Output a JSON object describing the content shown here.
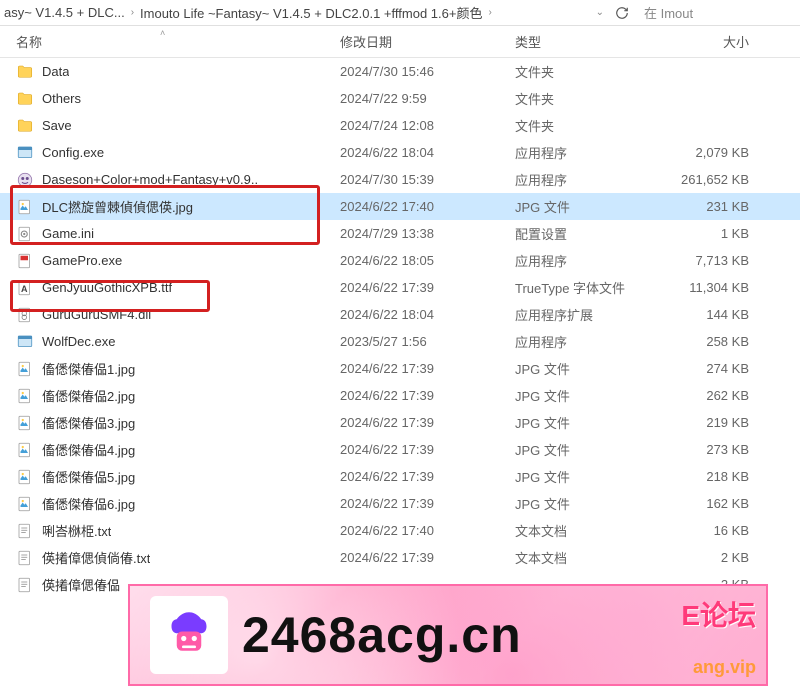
{
  "breadcrumb": {
    "item1": "asy~ V1.4.5 + DLC...",
    "item2": "Imouto Life ~Fantasy~ V1.4.5 + DLC2.0.1 +fffmod 1.6+颜色",
    "search_prefix": "在 Imout"
  },
  "headers": {
    "name": "名称",
    "date": "修改日期",
    "type": "类型",
    "size": "大小"
  },
  "files": [
    {
      "icon": "folder",
      "name": "Data",
      "date": "2024/7/30 15:46",
      "type": "文件夹",
      "size": ""
    },
    {
      "icon": "folder",
      "name": "Others",
      "date": "2024/7/22 9:59",
      "type": "文件夹",
      "size": ""
    },
    {
      "icon": "folder",
      "name": "Save",
      "date": "2024/7/24 12:08",
      "type": "文件夹",
      "size": ""
    },
    {
      "icon": "exe",
      "name": "Config.exe",
      "date": "2024/6/22 18:04",
      "type": "应用程序",
      "size": "2,079 KB"
    },
    {
      "icon": "app",
      "name": "Daseson+Color+mod+Fantasy+v0.9..",
      "date": "2024/7/30 15:39",
      "type": "应用程序",
      "size": "261,652 KB"
    },
    {
      "icon": "jpg",
      "name": "DLC撚旋曾棘偵偵偲偀.jpg",
      "date": "2024/6/22 17:40",
      "type": "JPG 文件",
      "size": "231 KB",
      "selected": true
    },
    {
      "icon": "ini",
      "name": "Game.ini",
      "date": "2024/7/29 13:38",
      "type": "配置设置",
      "size": "1 KB"
    },
    {
      "icon": "exe-red",
      "name": "GamePro.exe",
      "date": "2024/6/22 18:05",
      "type": "应用程序",
      "size": "7,713 KB"
    },
    {
      "icon": "font",
      "name": "GenJyuuGothicXPB.ttf",
      "date": "2024/6/22 17:39",
      "type": "TrueType 字体文件",
      "size": "11,304 KB"
    },
    {
      "icon": "dll",
      "name": "GuruGuruSMF4.dll",
      "date": "2024/6/22 18:04",
      "type": "应用程序扩展",
      "size": "144 KB"
    },
    {
      "icon": "exe",
      "name": "WolfDec.exe",
      "date": "2023/5/27 1:56",
      "type": "应用程序",
      "size": "258 KB"
    },
    {
      "icon": "jpg",
      "name": "傗僁傑偆偘1.jpg",
      "date": "2024/6/22 17:39",
      "type": "JPG 文件",
      "size": "274 KB"
    },
    {
      "icon": "jpg",
      "name": "傗僁傑偆偘2.jpg",
      "date": "2024/6/22 17:39",
      "type": "JPG 文件",
      "size": "262 KB"
    },
    {
      "icon": "jpg",
      "name": "傗僁傑偆偘3.jpg",
      "date": "2024/6/22 17:39",
      "type": "JPG 文件",
      "size": "219 KB"
    },
    {
      "icon": "jpg",
      "name": "傗僁傑偆偘4.jpg",
      "date": "2024/6/22 17:39",
      "type": "JPG 文件",
      "size": "273 KB"
    },
    {
      "icon": "jpg",
      "name": "傗僁傑偆偘5.jpg",
      "date": "2024/6/22 17:39",
      "type": "JPG 文件",
      "size": "218 KB"
    },
    {
      "icon": "jpg",
      "name": "傗僁傑偆偘6.jpg",
      "date": "2024/6/22 17:39",
      "type": "JPG 文件",
      "size": "162 KB"
    },
    {
      "icon": "txt",
      "name": "唎峇椕栕.txt",
      "date": "2024/6/22 17:40",
      "type": "文本文档",
      "size": "16 KB"
    },
    {
      "icon": "txt",
      "name": "偀撯傽偲偵倘偆.txt",
      "date": "2024/6/22 17:39",
      "type": "文本文档",
      "size": "2 KB"
    },
    {
      "icon": "txt",
      "name": "偀撯傽偲偆偘",
      "date": "",
      "type": "",
      "size": "2 KB"
    }
  ],
  "banner": {
    "text": "2468acg.cn",
    "side1": "E论坛",
    "side2": "ang.vip"
  },
  "icons": {
    "folder_color": "#ffd35a",
    "exe_color": "#5aa0d8"
  }
}
